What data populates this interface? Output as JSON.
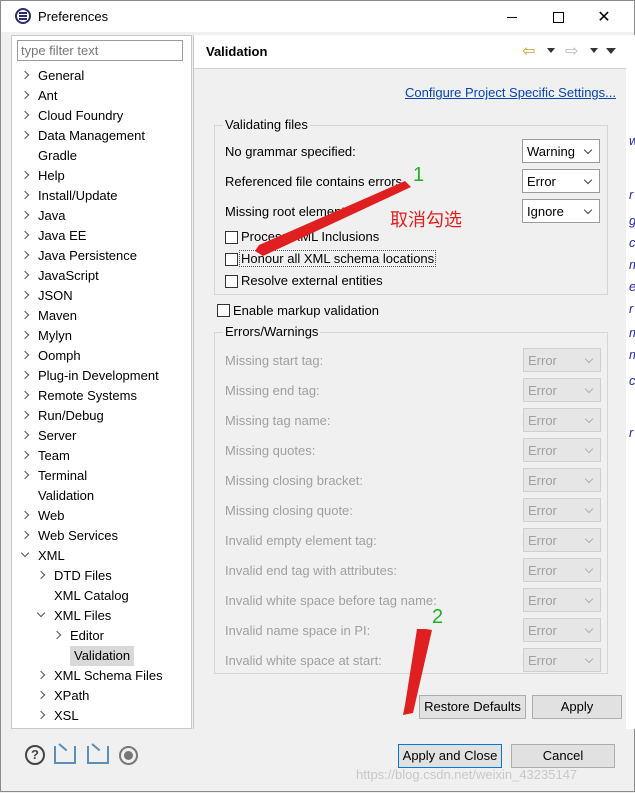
{
  "window": {
    "title": "Preferences"
  },
  "filter": {
    "placeholder": "type filter text"
  },
  "tree": [
    {
      "label": "General",
      "level": 0,
      "arrow": "collapsed"
    },
    {
      "label": "Ant",
      "level": 0,
      "arrow": "collapsed"
    },
    {
      "label": "Cloud Foundry",
      "level": 0,
      "arrow": "collapsed"
    },
    {
      "label": "Data Management",
      "level": 0,
      "arrow": "collapsed"
    },
    {
      "label": "Gradle",
      "level": 0,
      "arrow": "none"
    },
    {
      "label": "Help",
      "level": 0,
      "arrow": "collapsed"
    },
    {
      "label": "Install/Update",
      "level": 0,
      "arrow": "collapsed"
    },
    {
      "label": "Java",
      "level": 0,
      "arrow": "collapsed"
    },
    {
      "label": "Java EE",
      "level": 0,
      "arrow": "collapsed"
    },
    {
      "label": "Java Persistence",
      "level": 0,
      "arrow": "collapsed"
    },
    {
      "label": "JavaScript",
      "level": 0,
      "arrow": "collapsed"
    },
    {
      "label": "JSON",
      "level": 0,
      "arrow": "collapsed"
    },
    {
      "label": "Maven",
      "level": 0,
      "arrow": "collapsed"
    },
    {
      "label": "Mylyn",
      "level": 0,
      "arrow": "collapsed"
    },
    {
      "label": "Oomph",
      "level": 0,
      "arrow": "collapsed"
    },
    {
      "label": "Plug-in Development",
      "level": 0,
      "arrow": "collapsed"
    },
    {
      "label": "Remote Systems",
      "level": 0,
      "arrow": "collapsed"
    },
    {
      "label": "Run/Debug",
      "level": 0,
      "arrow": "collapsed"
    },
    {
      "label": "Server",
      "level": 0,
      "arrow": "collapsed"
    },
    {
      "label": "Team",
      "level": 0,
      "arrow": "collapsed"
    },
    {
      "label": "Terminal",
      "level": 0,
      "arrow": "collapsed"
    },
    {
      "label": "Validation",
      "level": 0,
      "arrow": "none"
    },
    {
      "label": "Web",
      "level": 0,
      "arrow": "collapsed"
    },
    {
      "label": "Web Services",
      "level": 0,
      "arrow": "collapsed"
    },
    {
      "label": "XML",
      "level": 0,
      "arrow": "expanded"
    },
    {
      "label": "DTD Files",
      "level": 1,
      "arrow": "collapsed"
    },
    {
      "label": "XML Catalog",
      "level": 1,
      "arrow": "none"
    },
    {
      "label": "XML Files",
      "level": 1,
      "arrow": "expanded"
    },
    {
      "label": "Editor",
      "level": 2,
      "arrow": "collapsed"
    },
    {
      "label": "Validation",
      "level": 2,
      "arrow": "none",
      "selected": true
    },
    {
      "label": "XML Schema Files",
      "level": 1,
      "arrow": "collapsed"
    },
    {
      "label": "XPath",
      "level": 1,
      "arrow": "collapsed"
    },
    {
      "label": "XSL",
      "level": 1,
      "arrow": "collapsed"
    }
  ],
  "page": {
    "title": "Validation",
    "config_link": "Configure Project Specific Settings..."
  },
  "validating": {
    "title": "Validating files",
    "rows": [
      {
        "label": "No grammar specified:",
        "value": "Warning"
      },
      {
        "label": "Referenced file contains errors",
        "value": "Error"
      },
      {
        "label": "Missing root element:",
        "value": "Ignore"
      }
    ],
    "checks": [
      {
        "label": "Process XML Inclusions",
        "checked": false
      },
      {
        "label": "Honour all XML schema locations",
        "checked": false
      },
      {
        "label": "Resolve external entities",
        "checked": false
      }
    ]
  },
  "markup": {
    "label": "Enable markup validation",
    "checked": false
  },
  "errors": {
    "title": "Errors/Warnings",
    "rows": [
      {
        "label": "Missing start tag:",
        "value": "Error"
      },
      {
        "label": "Missing end tag:",
        "value": "Error"
      },
      {
        "label": "Missing tag name:",
        "value": "Error"
      },
      {
        "label": "Missing quotes:",
        "value": "Error"
      },
      {
        "label": "Missing closing bracket:",
        "value": "Error"
      },
      {
        "label": "Missing closing quote:",
        "value": "Error"
      },
      {
        "label": "Invalid empty element tag:",
        "value": "Error"
      },
      {
        "label": "Invalid end tag with attributes:",
        "value": "Error"
      },
      {
        "label": "Invalid white space before tag name:",
        "value": "Error"
      },
      {
        "label": "Invalid name space in PI:",
        "value": "Error"
      },
      {
        "label": "Invalid white space at start:",
        "value": "Error"
      }
    ]
  },
  "buttons": {
    "restore": "Restore Defaults",
    "apply": "Apply",
    "apply_close": "Apply and Close",
    "cancel": "Cancel"
  },
  "annotations": {
    "num1": "1",
    "num2": "2",
    "note": "取消勾选"
  },
  "watermark": "https://blog.csdn.net/weixin_43235147",
  "edge_chars": [
    "w",
    "r",
    "g",
    "c",
    "m",
    "e",
    "r",
    "m",
    "m",
    "c",
    "r"
  ],
  "colors": {
    "link": "#0645ad",
    "annotation_red": "#e02020",
    "annotation_green": "#22b022",
    "selected_bg": "#d9d9d9"
  }
}
